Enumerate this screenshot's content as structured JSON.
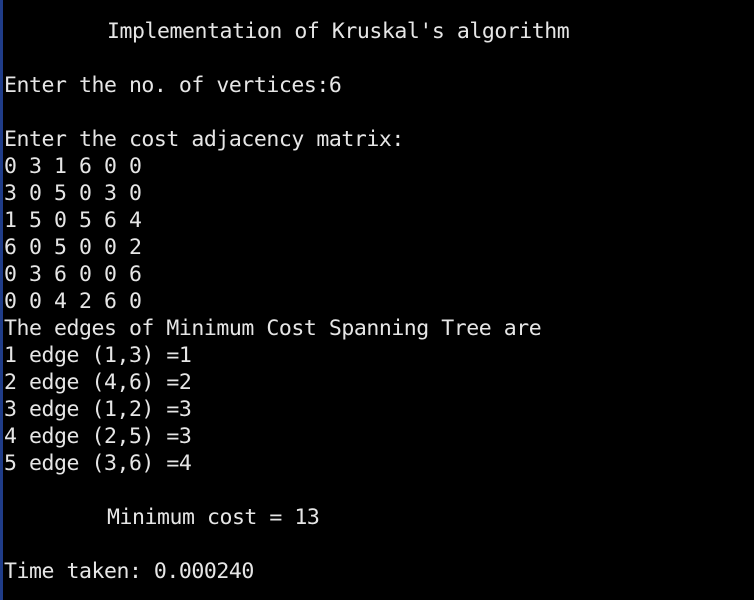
{
  "console": {
    "title": "Implementation of Kruskal's algorithm",
    "vertices_prompt": "Enter the no. of vertices:6",
    "matrix_prompt": "Enter the cost adjacency matrix:",
    "matrix_rows": [
      "0 3 1 6 0 0",
      "3 0 5 0 3 0",
      "1 5 0 5 6 4",
      "6 0 5 0 0 2",
      "0 3 6 0 0 6",
      "0 0 4 2 6 0"
    ],
    "edges_heading": "The edges of Minimum Cost Spanning Tree are",
    "edges": [
      "1 edge (1,3) =1",
      "2 edge (4,6) =2",
      "3 edge (1,2) =3",
      "4 edge (2,5) =3",
      "5 edge (3,6) =4"
    ],
    "min_cost": "Minimum cost = 13",
    "time_taken": "Time taken: 0.000240"
  },
  "colors": {
    "background": "#000000",
    "text": "#e6e6e6",
    "left_edge": "#1f3c88"
  }
}
